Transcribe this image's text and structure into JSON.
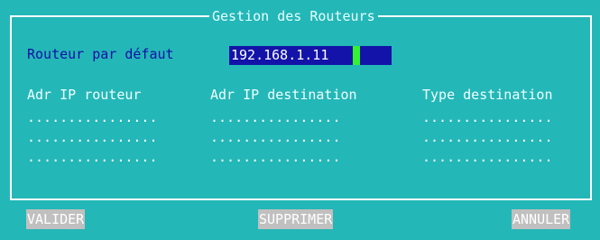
{
  "window": {
    "title": "Gestion des Routeurs"
  },
  "default_router": {
    "label": "Routeur par défaut",
    "value": "192.168.1.11"
  },
  "table": {
    "headers": [
      "Adr IP routeur",
      "Adr IP destination",
      "Type destination"
    ],
    "rows": [
      [
        "................",
        "................",
        "................"
      ],
      [
        "................",
        "................",
        "................"
      ],
      [
        "................",
        "................",
        "................"
      ]
    ]
  },
  "buttons": {
    "validate": "VALIDER",
    "delete": "SUPPRIMER",
    "cancel": "ANNULER"
  },
  "colors": {
    "background": "#24b7b7",
    "field": "#1313a9",
    "cursor": "#32f232",
    "label": "#1010a8",
    "button": "#c0c0c0"
  }
}
